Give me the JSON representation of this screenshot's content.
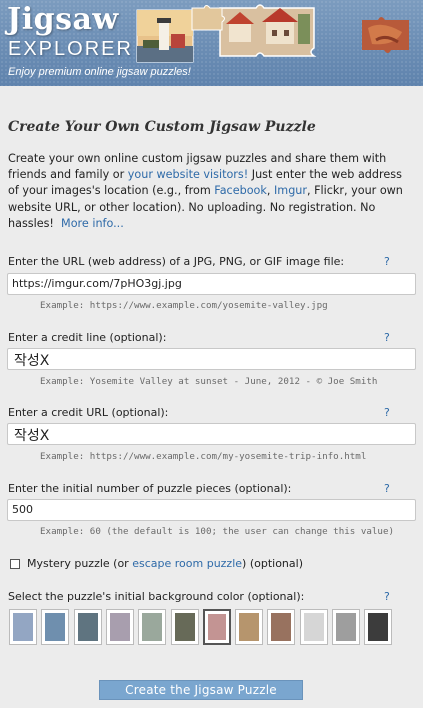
{
  "header": {
    "logo_line1": "Jigsaw",
    "logo_line2": "EXPLORER",
    "tagline": "Enjoy premium online jigsaw puzzles!"
  },
  "page_title": "Create Your Own Custom Jigsaw Puzzle",
  "intro": {
    "part1": "Create your own online custom jigsaw puzzles and share them with friends and family or ",
    "link_visitors": "your website visitors!",
    "part2": " Just enter the web address of your images's location (e.g., from ",
    "link_facebook": "Facebook",
    "comma1": ", ",
    "link_imgur": "Imgur",
    "part3": ", Flickr, your own website URL, or other location). No uploading. No registration. No hassles!",
    "link_more": "More info..."
  },
  "url_field": {
    "label": "Enter the URL (web address) of a JPG, PNG, or GIF image file:",
    "help": "?",
    "value": "https://imgur.com/7pHO3gj.jpg",
    "example": "Example: https://www.example.com/yosemite-valley.jpg"
  },
  "credit_line": {
    "label": "Enter a credit line (optional):",
    "help": "?",
    "value": "작성X",
    "example": "Example: Yosemite Valley at sunset - June, 2012 - © Joe Smith"
  },
  "credit_url": {
    "label": "Enter a credit URL (optional):",
    "help": "?",
    "value": "작성X",
    "example": "Example: https://www.example.com/my-yosemite-trip-info.html"
  },
  "pieces": {
    "label": "Enter the initial number of puzzle pieces (optional):",
    "help": "?",
    "value": "500",
    "example": "Example: 60 (the default is 100; the user can change this value)"
  },
  "mystery": {
    "label_pre": "Mystery puzzle (or ",
    "link": "escape room puzzle",
    "label_post": ") (optional)",
    "checked": false
  },
  "background": {
    "label": "Select the puzzle's initial background color (optional):",
    "help": "?",
    "colors": [
      "#93a6c3",
      "#6f8fae",
      "#5f7480",
      "#a89eae",
      "#9aa89c",
      "#676a58",
      "#c39493",
      "#b6956d",
      "#98725f",
      "#d6d6d6",
      "#9e9e9e",
      "#3c3c3c"
    ],
    "selected_index": 6
  },
  "submit_label": "Create the Jigsaw Puzzle"
}
